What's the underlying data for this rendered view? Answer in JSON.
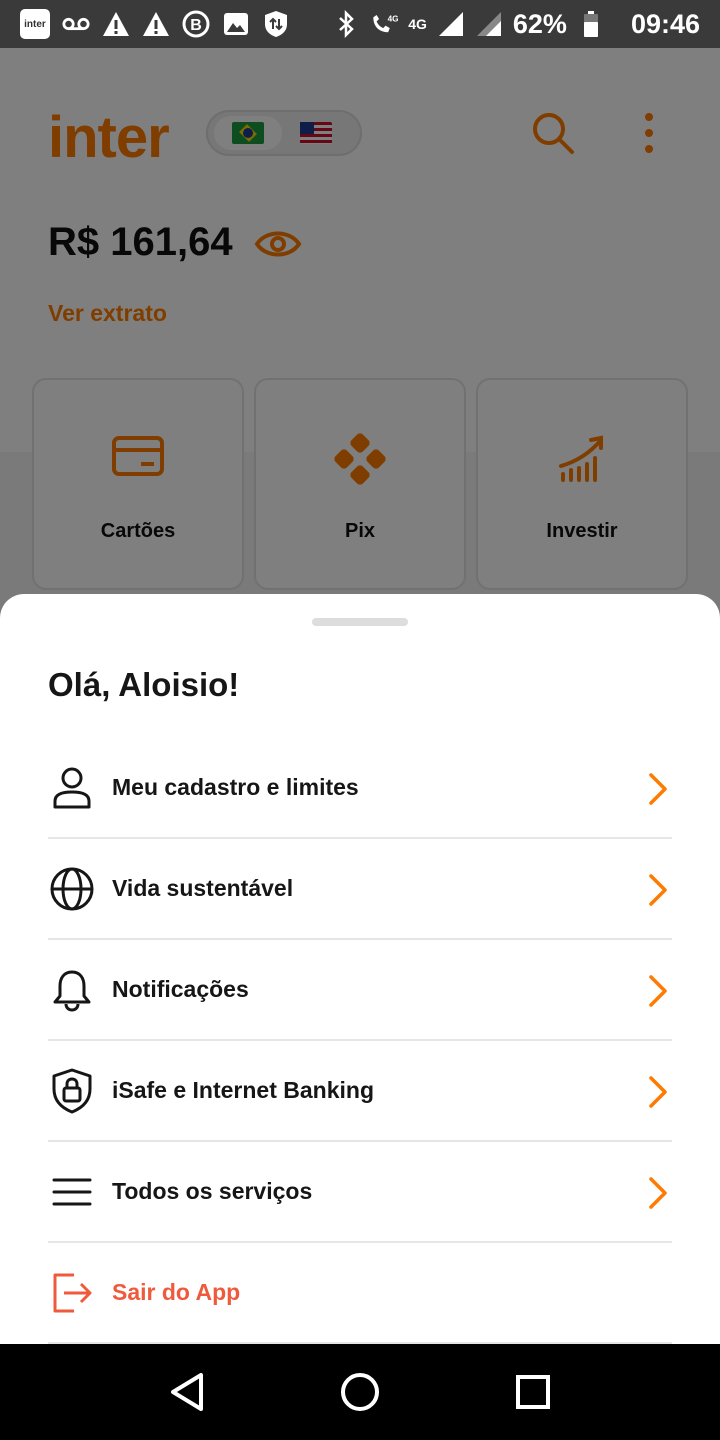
{
  "status_bar": {
    "battery": "62%",
    "time": "09:46",
    "network": "4G",
    "network_small": "4G",
    "app_icon_text": "inter"
  },
  "app": {
    "logo": "inter",
    "balance": "R$ 161,64",
    "extrato_label": "Ver extrato",
    "accent_color": "#ff7a00",
    "tiles": [
      {
        "label": "Cartões",
        "icon": "card-icon"
      },
      {
        "label": "Pix",
        "icon": "pix-icon"
      },
      {
        "label": "Investir",
        "icon": "chart-up-icon"
      }
    ]
  },
  "sheet": {
    "greeting": "Olá, Aloisio!",
    "items": [
      {
        "label": "Meu cadastro e limites",
        "icon": "user-icon"
      },
      {
        "label": "Vida sustentável",
        "icon": "globe-icon"
      },
      {
        "label": "Notificações",
        "icon": "bell-icon"
      },
      {
        "label": "iSafe e Internet Banking",
        "icon": "shield-lock-icon"
      },
      {
        "label": "Todos os serviços",
        "icon": "menu-icon"
      },
      {
        "label": "Sair do App",
        "icon": "logout-icon"
      }
    ],
    "exit_color": "#f05a3c"
  },
  "nav": {
    "back": "back-icon",
    "home": "home-icon",
    "recents": "recents-icon"
  }
}
